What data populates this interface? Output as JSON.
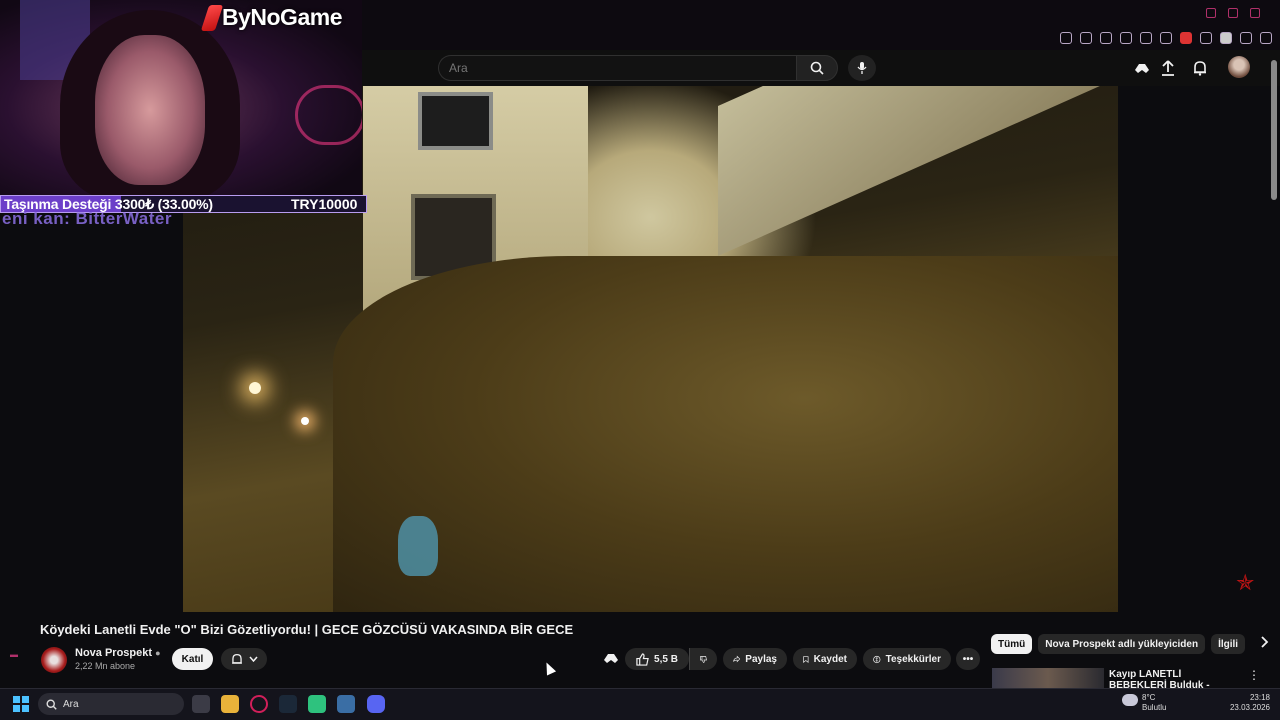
{
  "stream_overlay": {
    "brand": "ByNoGame",
    "donation_label": "Taşınma Desteği 3300₺ (33.00%)",
    "donation_goal": "TRY10000",
    "donation_progress": 0.33,
    "ticker_text": "eni kan: BitterWater"
  },
  "header": {
    "search_placeholder": "Ara"
  },
  "video": {
    "title": "Köydeki Lanetli Evde \"O\" Bizi Gözetliyordu! | GECE GÖZCÜSÜ VAKASINDA BİR GECE"
  },
  "channel": {
    "name": "Nova Prospekt",
    "subscribers": "2,22 Mn abone",
    "join_label": "Katıl"
  },
  "actions": {
    "likes": "5,5 B",
    "share": "Paylaş",
    "save": "Kaydet",
    "thanks": "Teşekkürler"
  },
  "chips": [
    "Tümü",
    "Nova Prospekt adlı yükleyiciden",
    "İlgili"
  ],
  "recommendation": {
    "title": "Kayıp LANETLİ BEBEKLERİ Bulduk - Katilin Evinde Korkun..."
  },
  "taskbar": {
    "search_label": "Ara",
    "weather_temp": "8°C",
    "weather_desc": "Bulutlu",
    "time": "23:18",
    "date": "23.03.2026"
  },
  "colors": {
    "donation_fill": "#6c3fc9",
    "accent_red": "#c01414"
  }
}
